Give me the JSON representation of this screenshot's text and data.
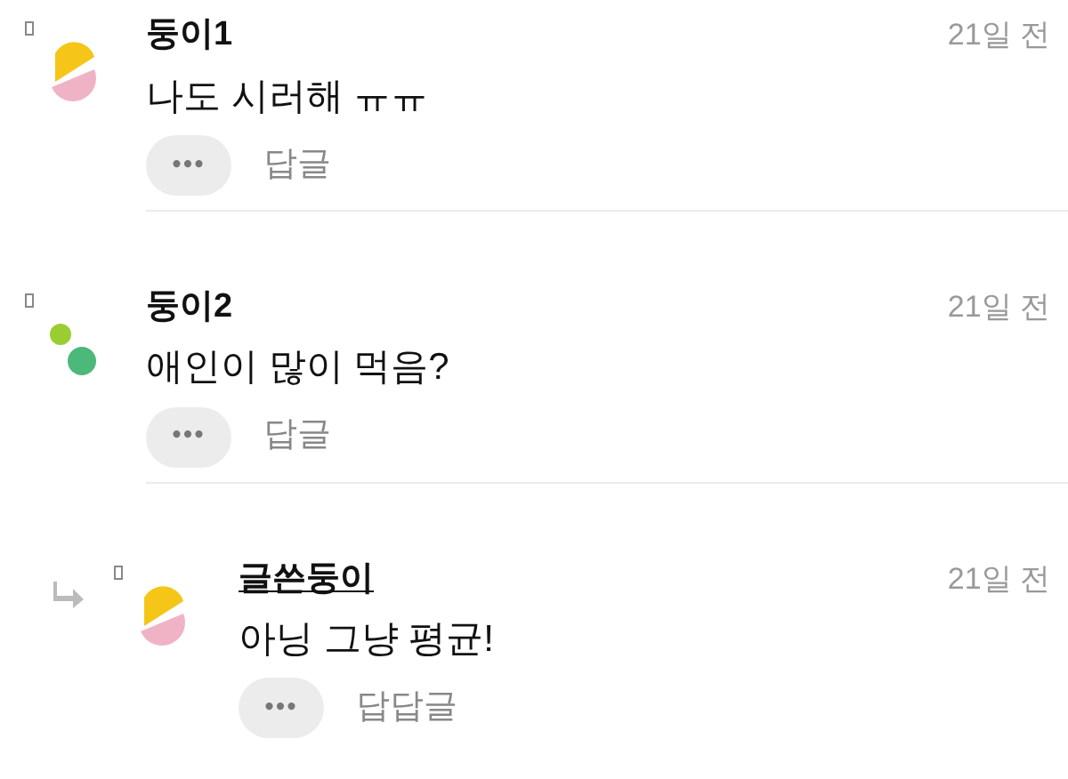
{
  "comments": [
    {
      "author": "둥이1",
      "is_writer": false,
      "is_reply": false,
      "avatar": {
        "kind": "halves"
      },
      "time": "21일 전",
      "text": "나도 시러해 ㅠㅠ",
      "more": "•••",
      "reply_label": "답글"
    },
    {
      "author": "둥이2",
      "is_writer": false,
      "is_reply": false,
      "avatar": {
        "kind": "dots"
      },
      "time": "21일 전",
      "text": "애인이 많이 먹음?",
      "more": "•••",
      "reply_label": "답글"
    },
    {
      "author": "글쓴둥이",
      "is_writer": true,
      "is_reply": true,
      "avatar": {
        "kind": "halves"
      },
      "time": "21일 전",
      "text": "아닝 그냥 평균!",
      "more": "•••",
      "reply_label": "답답글"
    }
  ]
}
